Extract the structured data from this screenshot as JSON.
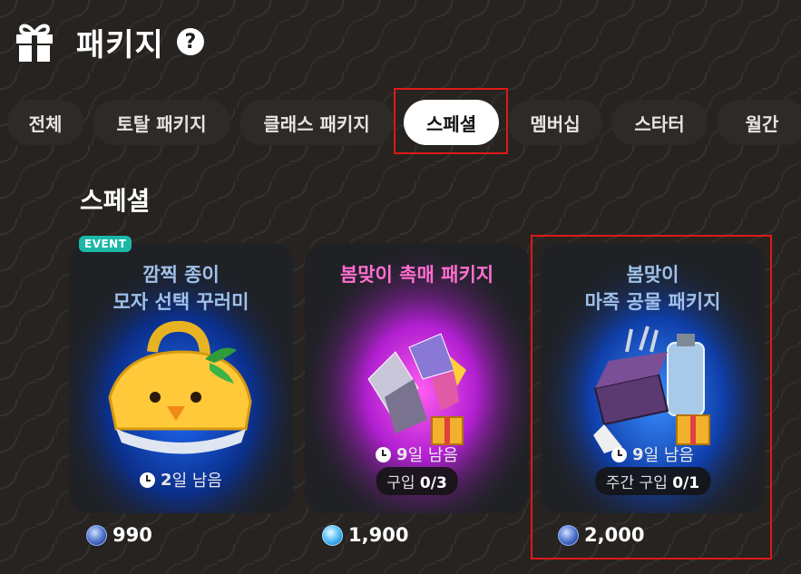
{
  "header": {
    "title": "패키지",
    "help_label": "?"
  },
  "tabs": [
    {
      "label": "전체"
    },
    {
      "label": "토탈 패키지"
    },
    {
      "label": "클래스 패키지"
    },
    {
      "label": "스페셜",
      "active": true
    },
    {
      "label": "멤버십"
    },
    {
      "label": "스타터"
    },
    {
      "label": "월간"
    }
  ],
  "section": {
    "title": "스페셜"
  },
  "cards": [
    {
      "badge": "EVENT",
      "name_line1": "깜찍 종이",
      "name_line2": "모자 선택 꾸러미",
      "timer_value": "2",
      "timer_unit": "일 남음",
      "price": "990",
      "price_icon": "coin-icon"
    },
    {
      "name_line1": "봄맞이 촉매 패키지",
      "timer_value": "9",
      "timer_unit": "일 남음",
      "limit_label": "구입",
      "limit_value": "0/3",
      "price": "1,900",
      "price_icon": "gem-icon"
    },
    {
      "name_line1": "봄맞이",
      "name_line2": "마족 공물 패키지",
      "timer_value": "9",
      "timer_unit": "일 남음",
      "limit_label": "주간 구입",
      "limit_value": "0/1",
      "price": "2,000",
      "price_icon": "coin-icon"
    }
  ],
  "colors": {
    "background": "#262320",
    "card": "#1f2125",
    "highlight": "#e01818",
    "event_badge": "#1bb8a8",
    "pink_title": "#ff6fd0",
    "blue_title": "#9fc1ea"
  }
}
